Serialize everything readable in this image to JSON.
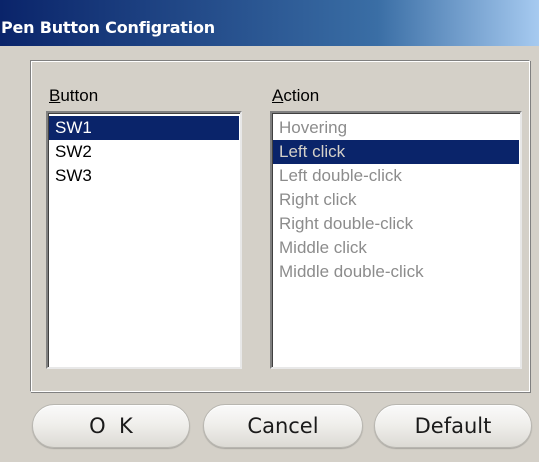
{
  "window": {
    "title": "Pen Button Configration"
  },
  "button_list": {
    "label_mnemonic": "B",
    "label_rest": "utton",
    "items": [
      "SW1",
      "SW2",
      "SW3"
    ],
    "selected": "SW1"
  },
  "action_list": {
    "label_mnemonic": "A",
    "label_rest": "ction",
    "items": [
      "Hovering",
      "Left click",
      "Left double-click",
      "Right click",
      "Right double-click",
      "Middle click",
      "Middle double-click"
    ],
    "selected": "Left click",
    "disabled": true
  },
  "buttons": {
    "ok": "O  K",
    "cancel": "Cancel",
    "default": "Default"
  },
  "colors": {
    "title_bar_start": "#0a246a",
    "title_bar_end": "#a6caf0",
    "selection": "#0a246a",
    "dialog_face": "#d4d0c8"
  }
}
